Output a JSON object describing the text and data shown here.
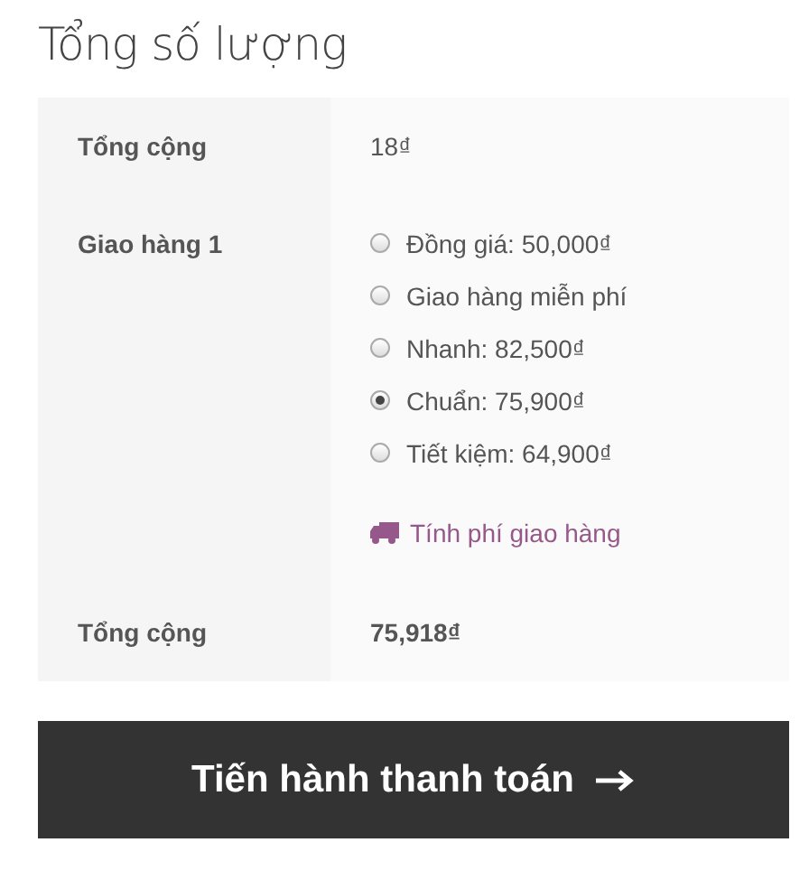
{
  "title": "Tổng số lượng",
  "rows": [
    {
      "kind": "subtotal",
      "label": "Tổng cộng",
      "value": "18₫"
    },
    {
      "kind": "shipping",
      "label": "Giao hàng 1",
      "options": [
        {
          "label": "Đồng giá: 50,000₫",
          "selected": false
        },
        {
          "label": "Giao hàng miễn phí",
          "selected": false
        },
        {
          "label": "Nhanh: 82,500₫",
          "selected": false
        },
        {
          "label": "Chuẩn: 75,900₫",
          "selected": true
        },
        {
          "label": "Tiết kiệm: 64,900₫",
          "selected": false
        }
      ],
      "calculator_link": "Tính phí giao hàng"
    },
    {
      "kind": "total",
      "label": "Tổng cộng",
      "value": "75,918₫"
    }
  ],
  "checkout_button": "Tiến hành thanh toán"
}
